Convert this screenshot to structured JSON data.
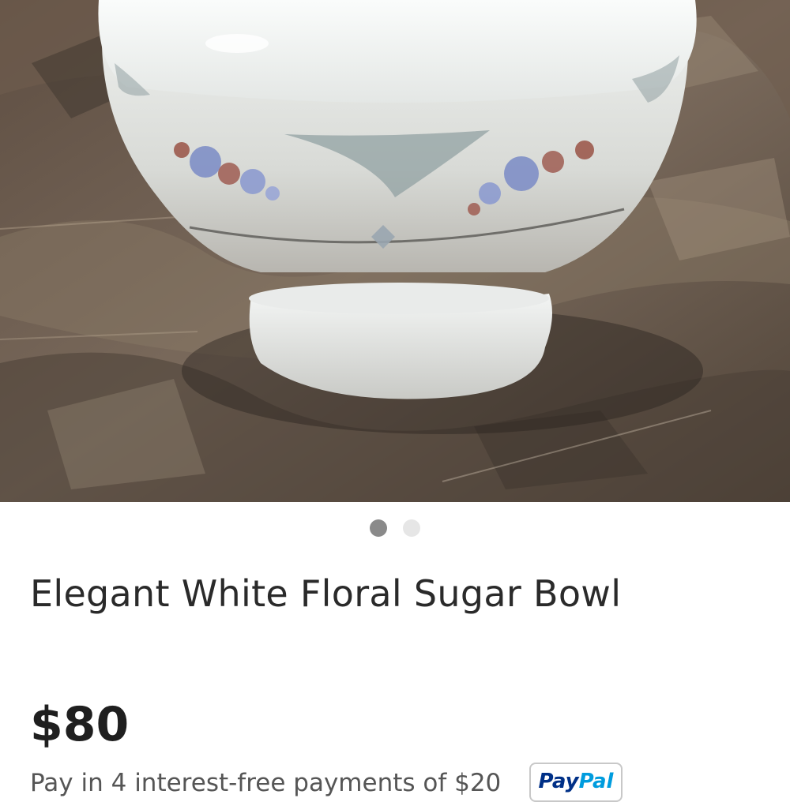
{
  "listing": {
    "title": "Elegant White Floral Sugar Bowl",
    "price": "$80",
    "installments_text": "Pay in 4 interest-free payments of $20",
    "paypal_badge": {
      "part1": "Pay",
      "part2": "Pal"
    }
  },
  "gallery": {
    "image_count": 2,
    "active_index": 0,
    "image_alt": "White porcelain sugar bowl with floral pattern on a brown camouflage fabric"
  },
  "colors": {
    "dot_active": "#8a8a8a",
    "dot_inactive": "#e6e6e6",
    "paypal_dark": "#003087",
    "paypal_light": "#009cde"
  }
}
